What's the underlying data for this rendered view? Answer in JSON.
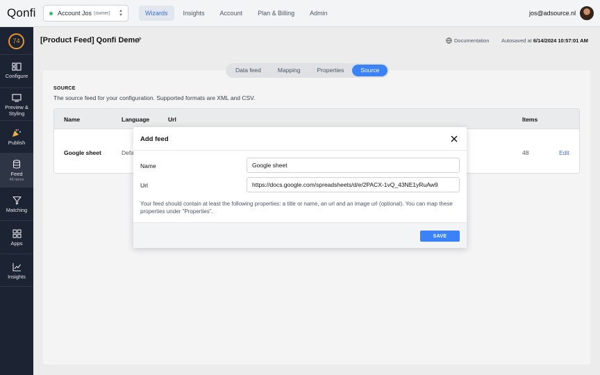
{
  "app": {
    "logo": "Qonfi"
  },
  "account": {
    "name": "Account Jos",
    "role": "(owner)"
  },
  "nav": [
    {
      "label": "Wizards",
      "active": true
    },
    {
      "label": "Insights"
    },
    {
      "label": "Account"
    },
    {
      "label": "Plan & Billing"
    },
    {
      "label": "Admin"
    }
  ],
  "user": {
    "email": "jos@adsource.nl"
  },
  "sidebar": {
    "score": "74",
    "items": [
      {
        "label": "Configure",
        "icon": "configure-icon"
      },
      {
        "label": "Preview & Styling",
        "icon": "monitor-icon"
      },
      {
        "label": "Publish",
        "icon": "party-icon"
      },
      {
        "label": "Feed",
        "sub": "48 items",
        "icon": "database-icon",
        "active": true
      },
      {
        "label": "Matching",
        "icon": "funnel-icon"
      },
      {
        "label": "Apps",
        "icon": "grid-icon"
      },
      {
        "label": "Insights",
        "icon": "chart-icon"
      }
    ]
  },
  "header": {
    "title": "[Product Feed] Qonfi Demo",
    "documentation": "Documentation",
    "autosaved_label": "Autosaved at",
    "autosaved_time": "6/14/2024 10:57:01 AM"
  },
  "tabs": [
    {
      "label": "Data feed"
    },
    {
      "label": "Mapping"
    },
    {
      "label": "Properties"
    },
    {
      "label": "Source",
      "active": true
    }
  ],
  "source": {
    "title": "SOURCE",
    "description": "The source feed for your configuration. Supported formats are XML and CSV.",
    "columns": {
      "name": "Name",
      "language": "Language",
      "url": "Url",
      "items": "Items"
    },
    "row": {
      "name": "Google sheet",
      "language": "Defa",
      "items": "48",
      "action": "Edit"
    }
  },
  "modal": {
    "title": "Add feed",
    "name_label": "Name",
    "name_value": "Google sheet",
    "url_label": "Url",
    "url_value": "https://docs.google.com/spreadsheets/d/e/2PACX-1vQ_43NE1yRuAw9",
    "hint": "Your feed should contain at least the following properties: a title or name, an url and an image url (optional). You can map these properties under \"Properties\".",
    "save_label": "SAVE"
  },
  "colors": {
    "accent": "#3b82f6",
    "sidebar": "#1c2332",
    "score": "#e8962f"
  }
}
